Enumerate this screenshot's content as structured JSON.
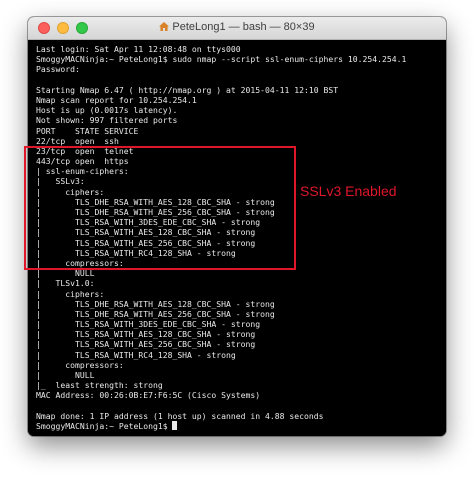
{
  "window": {
    "title": "PeteLong1 — bash — 80×39",
    "home_icon": "home-icon"
  },
  "terminal": {
    "lines": [
      "Last login: Sat Apr 11 12:08:48 on ttys000",
      "SmoggyMACNinja:~ PeteLong1$ sudo nmap --script ssl-enum-ciphers 10.254.254.1",
      "Password:",
      "",
      "Starting Nmap 6.47 ( http://nmap.org ) at 2015-04-11 12:10 BST",
      "Nmap scan report for 10.254.254.1",
      "Host is up (0.0017s latency).",
      "Not shown: 997 filtered ports",
      "PORT    STATE SERVICE",
      "22/tcp  open  ssh",
      "23/tcp  open  telnet",
      "443/tcp open  https",
      "| ssl-enum-ciphers:",
      "|   SSLv3:",
      "|     ciphers:",
      "|       TLS_DHE_RSA_WITH_AES_128_CBC_SHA - strong",
      "|       TLS_DHE_RSA_WITH_AES_256_CBC_SHA - strong",
      "|       TLS_RSA_WITH_3DES_EDE_CBC_SHA - strong",
      "|       TLS_RSA_WITH_AES_128_CBC_SHA - strong",
      "|       TLS_RSA_WITH_AES_256_CBC_SHA - strong",
      "|       TLS_RSA_WITH_RC4_128_SHA - strong",
      "|     compressors:",
      "|       NULL",
      "|   TLSv1.0:",
      "|     ciphers:",
      "|       TLS_DHE_RSA_WITH_AES_128_CBC_SHA - strong",
      "|       TLS_DHE_RSA_WITH_AES_256_CBC_SHA - strong",
      "|       TLS_RSA_WITH_3DES_EDE_CBC_SHA - strong",
      "|       TLS_RSA_WITH_AES_128_CBC_SHA - strong",
      "|       TLS_RSA_WITH_AES_256_CBC_SHA - strong",
      "|       TLS_RSA_WITH_RC4_128_SHA - strong",
      "|     compressors:",
      "|       NULL",
      "|_  least strength: strong",
      "MAC Address: 00:26:0B:E7:F6:5C (Cisco Systems)",
      "",
      "Nmap done: 1 IP address (1 host up) scanned in 4.88 seconds",
      "SmoggyMACNinja:~ PeteLong1$ "
    ]
  },
  "annotation": {
    "label": "SSLv3 Enabled",
    "color": "#e0162b"
  },
  "colors": {
    "terminal_bg": "#000000",
    "terminal_fg": "#e9e9e9",
    "close": "#fc605c",
    "minimize": "#fdbc40",
    "maximize": "#34c84a"
  }
}
